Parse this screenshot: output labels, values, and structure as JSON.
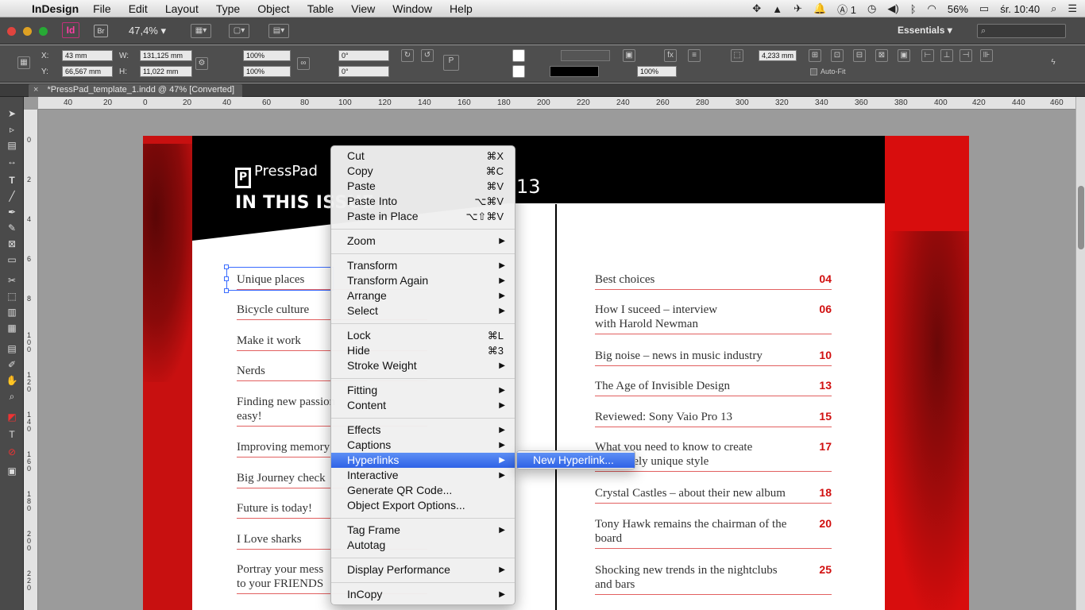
{
  "menubar": {
    "app_name": "InDesign",
    "items": [
      "File",
      "Edit",
      "Layout",
      "Type",
      "Object",
      "Table",
      "View",
      "Window",
      "Help"
    ],
    "status": {
      "adobe_count": "1",
      "battery": "56%",
      "clock": "śr. 10:40"
    }
  },
  "appbar": {
    "app_logo": "Id",
    "bridge": "Br",
    "zoom": "47,4%",
    "workspace": "Essentials"
  },
  "control": {
    "x_label": "X:",
    "x_value": "43 mm",
    "y_label": "Y:",
    "y_value": "66,567 mm",
    "w_label": "W:",
    "w_value": "131,125 mm",
    "h_label": "H:",
    "h_value": "11,022 mm",
    "scale_x": "100%",
    "scale_y": "100%",
    "angle": "0°",
    "shear": "0°",
    "stroke_pct": "100%",
    "offset": "4,233 mm",
    "autofit": "Auto-Fit"
  },
  "document": {
    "tab_title": "*PressPad_template_1.indd @ 47% [Converted]"
  },
  "ruler": {
    "h_ticks": [
      "40",
      "20",
      "0",
      "20",
      "40",
      "60",
      "80",
      "100",
      "120",
      "140",
      "160",
      "180",
      "200",
      "220",
      "240",
      "260",
      "280",
      "300",
      "320",
      "340",
      "360",
      "380",
      "400",
      "420",
      "440",
      "460"
    ],
    "v_ticks": [
      "0",
      "2",
      "4",
      "6",
      "8",
      "100",
      "120",
      "140",
      "160",
      "180",
      "200",
      "220"
    ]
  },
  "page": {
    "logo": "PressPad",
    "title": "IN THIS ISSUE",
    "issue_number": "13",
    "left_toc": [
      {
        "title": "Unique places"
      },
      {
        "title": "Bicycle culture"
      },
      {
        "title": "Make it work"
      },
      {
        "title": "Nerds"
      },
      {
        "title": "Finding new passion",
        "title2": "easy!"
      },
      {
        "title": "Improving memory"
      },
      {
        "title": "Big Journey check"
      },
      {
        "title": "Future is today!"
      },
      {
        "title": "I Love sharks"
      },
      {
        "title": "Portray your mess",
        "title2": "to your FRIENDS"
      }
    ],
    "right_toc": [
      {
        "title": "Best choices",
        "num": "04"
      },
      {
        "title": "How I suceed – interview",
        "title2": "with Harold Newman",
        "num": "06"
      },
      {
        "title": "Big noise – news in music industry",
        "num": "10"
      },
      {
        "title": "The Age of Invisible Design",
        "num": "13"
      },
      {
        "title": "Reviewed: Sony Vaio Pro 13",
        "num": "15"
      },
      {
        "title": "What you need to know to create",
        "title2": "completely unique style",
        "num": "17"
      },
      {
        "title": "Crystal Castles – about their new album",
        "num": "18"
      },
      {
        "title": "Tony Hawk remains the chairman of the",
        "title2": "board",
        "num": "20"
      },
      {
        "title": "Shocking new trends in the nightclubs",
        "title2": "and bars",
        "num": "25"
      }
    ]
  },
  "context_menu": {
    "items": [
      {
        "label": "Cut",
        "shortcut": "⌘X"
      },
      {
        "label": "Copy",
        "shortcut": "⌘C"
      },
      {
        "label": "Paste",
        "shortcut": "⌘V"
      },
      {
        "label": "Paste Into",
        "shortcut": "⌥⌘V"
      },
      {
        "label": "Paste in Place",
        "shortcut": "⌥⇧⌘V"
      },
      {
        "label": "Zoom"
      },
      {
        "label": "Transform"
      },
      {
        "label": "Transform Again"
      },
      {
        "label": "Arrange"
      },
      {
        "label": "Select"
      },
      {
        "label": "Lock",
        "shortcut": "⌘L"
      },
      {
        "label": "Hide",
        "shortcut": "⌘3"
      },
      {
        "label": "Stroke Weight"
      },
      {
        "label": "Fitting"
      },
      {
        "label": "Content"
      },
      {
        "label": "Effects"
      },
      {
        "label": "Captions"
      },
      {
        "label": "Hyperlinks"
      },
      {
        "label": "Interactive"
      },
      {
        "label": "Generate QR Code..."
      },
      {
        "label": "Object Export Options..."
      },
      {
        "label": "Tag Frame"
      },
      {
        "label": "Autotag"
      },
      {
        "label": "Display Performance"
      },
      {
        "label": "InCopy"
      }
    ],
    "submenu": {
      "label": "New Hyperlink..."
    }
  }
}
